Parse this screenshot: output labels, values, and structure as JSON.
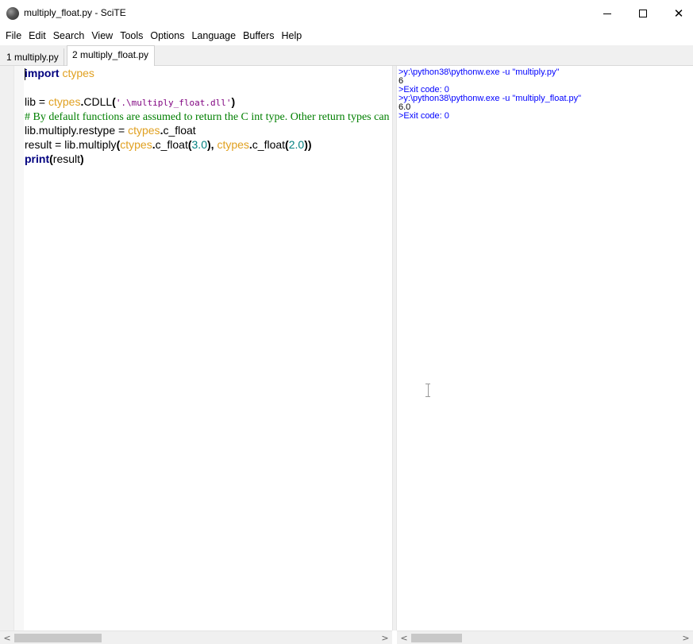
{
  "window": {
    "title": "multiply_float.py - SciTE",
    "icon": "scite-app-icon"
  },
  "menu": [
    "File",
    "Edit",
    "Search",
    "View",
    "Tools",
    "Options",
    "Language",
    "Buffers",
    "Help"
  ],
  "tabs": [
    {
      "label": "1 multiply.py",
      "active": false
    },
    {
      "label": "2 multiply_float.py",
      "active": true
    }
  ],
  "editor": {
    "lines": [
      [
        {
          "t": "import",
          "c": "kw"
        },
        {
          "t": " ",
          "c": ""
        },
        {
          "t": "ctypes",
          "c": "mod"
        }
      ],
      [],
      [
        {
          "t": "lib ",
          "c": ""
        },
        {
          "t": "=",
          "c": ""
        },
        {
          "t": " ",
          "c": ""
        },
        {
          "t": "ctypes",
          "c": "mod"
        },
        {
          "t": ".",
          "c": "op"
        },
        {
          "t": "CDLL",
          "c": ""
        },
        {
          "t": "(",
          "c": "op"
        },
        {
          "t": "'.\\multiply_float.dll'",
          "c": "str"
        },
        {
          "t": ")",
          "c": "op"
        }
      ],
      [
        {
          "t": "# By default functions are assumed to return the C int type. Other return types can",
          "c": "cmt"
        }
      ],
      [
        {
          "t": "lib.multiply.restype ",
          "c": ""
        },
        {
          "t": "=",
          "c": ""
        },
        {
          "t": " ",
          "c": ""
        },
        {
          "t": "ctypes",
          "c": "mod"
        },
        {
          "t": ".",
          "c": "op"
        },
        {
          "t": "c_float",
          "c": ""
        }
      ],
      [
        {
          "t": "result ",
          "c": ""
        },
        {
          "t": "=",
          "c": ""
        },
        {
          "t": " lib.multiply",
          "c": ""
        },
        {
          "t": "(",
          "c": "op"
        },
        {
          "t": "ctypes",
          "c": "mod"
        },
        {
          "t": ".",
          "c": "op"
        },
        {
          "t": "c_float",
          "c": ""
        },
        {
          "t": "(",
          "c": "op"
        },
        {
          "t": "3.0",
          "c": "num"
        },
        {
          "t": "),",
          "c": "op"
        },
        {
          "t": " ",
          "c": ""
        },
        {
          "t": "ctypes",
          "c": "mod"
        },
        {
          "t": ".",
          "c": "op"
        },
        {
          "t": "c_float",
          "c": ""
        },
        {
          "t": "(",
          "c": "op"
        },
        {
          "t": "2.0",
          "c": "num"
        },
        {
          "t": "))",
          "c": "op"
        }
      ],
      [
        {
          "t": "print",
          "c": "kw"
        },
        {
          "t": "(",
          "c": "op"
        },
        {
          "t": "result",
          "c": ""
        },
        {
          "t": ")",
          "c": "op"
        }
      ]
    ]
  },
  "output": {
    "lines": [
      {
        "text": ">y:\\python38\\pythonw.exe -u \"multiply.py\"",
        "kind": "cmd"
      },
      {
        "text": "6",
        "kind": "plain"
      },
      {
        "text": ">Exit code: 0",
        "kind": "cmd"
      },
      {
        "text": ">y:\\python38\\pythonw.exe -u \"multiply_float.py\"",
        "kind": "cmd"
      },
      {
        "text": "6.0",
        "kind": "plain"
      },
      {
        "text": ">Exit code: 0",
        "kind": "cmd"
      }
    ]
  },
  "scrollbars": {
    "left_arrow": "<",
    "right_arrow": ">"
  },
  "colors": {
    "keyword": "#00007f",
    "module": "#e0a020",
    "string": "#7f007f",
    "number": "#007f7f",
    "comment": "#007f00",
    "output_command": "#0000ff"
  }
}
